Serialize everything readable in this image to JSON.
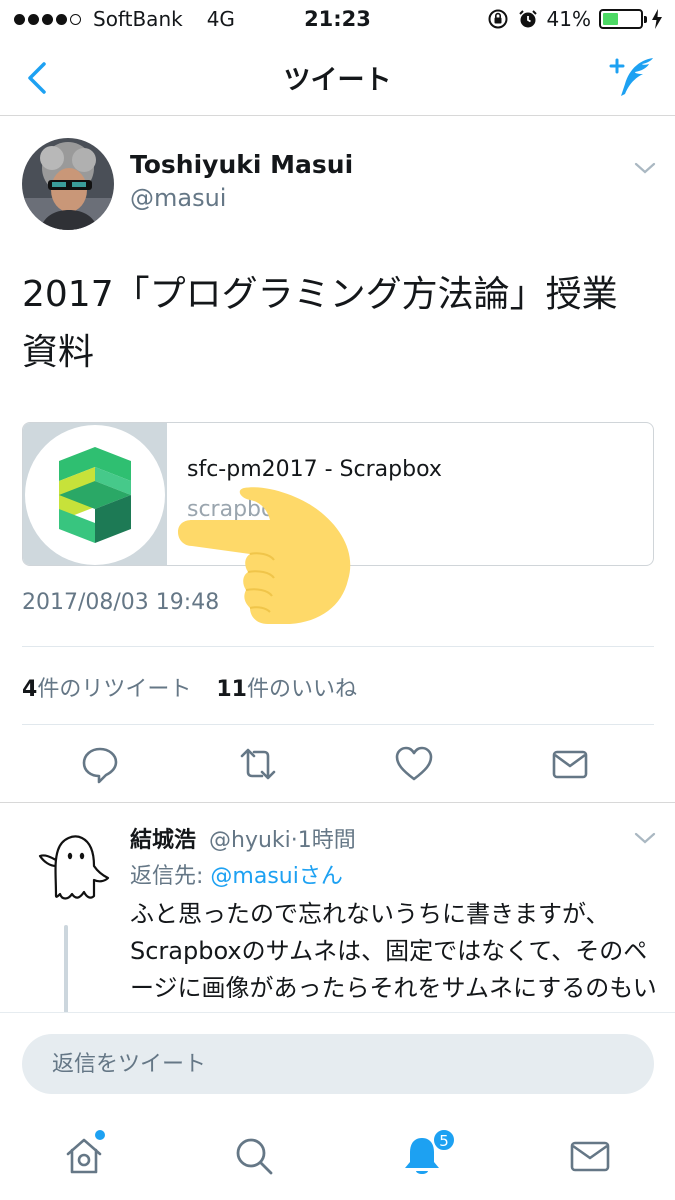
{
  "status_bar": {
    "carrier": "SoftBank",
    "network": "4G",
    "time": "21:23",
    "battery": "41%",
    "battery_level": 0.41
  },
  "nav": {
    "title": "ツイート"
  },
  "tweet": {
    "author_name": "Toshiyuki Masui",
    "author_handle": "@masui",
    "text": "2017「プログラミング方法論」授業資料",
    "card": {
      "title": "sfc-pm2017 - Scrapbox",
      "domain": "scrapbox.io"
    },
    "timestamp": "2017/08/03 19:48",
    "retweets_count": "4",
    "retweets_label": "件のリツイート",
    "likes_count": "11",
    "likes_label": "件のいいね"
  },
  "reply": {
    "author_name": "結城浩",
    "author_handle": "@hyuki",
    "separator": "·",
    "time_ago": "1時間",
    "reply_to_prefix": "返信先: ",
    "reply_to_mention": "@masuiさん",
    "text": "ふと思ったので忘れないうちに書きますが、Scrapboxのサムネは、固定ではなくて、そのページに画像があったらそれをサムネにするのもいいかなと思いました"
  },
  "composer": {
    "placeholder": "返信をツイート"
  },
  "tab_bar": {
    "notifications_badge": "5"
  },
  "colors": {
    "accent": "#1da1f2",
    "muted": "#657786",
    "battery": "#4cd964"
  }
}
